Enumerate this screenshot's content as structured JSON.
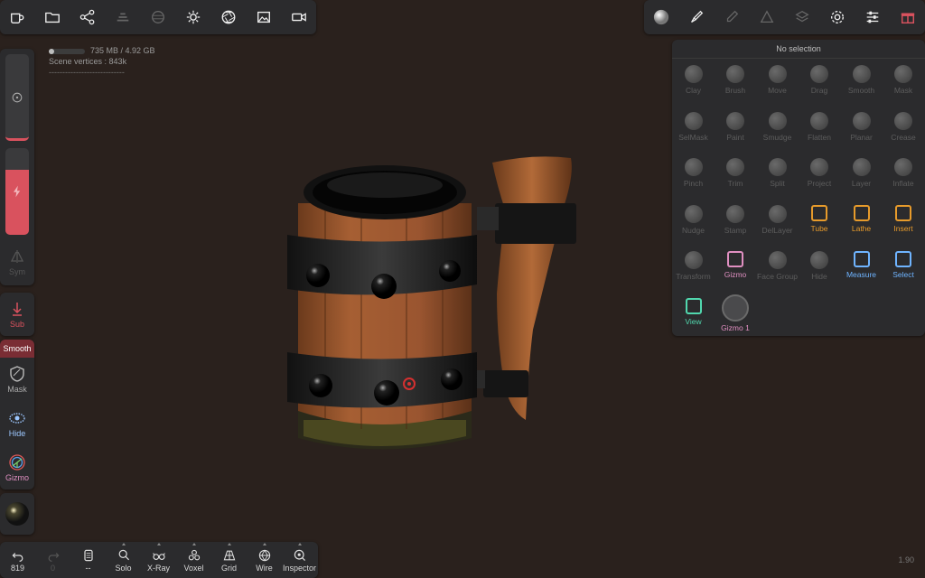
{
  "top_left_toolbar": [
    {
      "icon": "mug-icon"
    },
    {
      "icon": "folder-icon"
    },
    {
      "icon": "scene-graph-icon"
    },
    {
      "icon": "layers-stack-icon"
    },
    {
      "icon": "texture-icon"
    },
    {
      "icon": "sun-icon"
    },
    {
      "icon": "aperture-icon"
    },
    {
      "icon": "image-icon"
    },
    {
      "icon": "video-camera-icon"
    }
  ],
  "top_right_toolbar": [
    {
      "icon": "material-sphere-icon"
    },
    {
      "icon": "paint-brush-icon"
    },
    {
      "icon": "pen-icon"
    },
    {
      "icon": "triangle-icon"
    },
    {
      "icon": "layers-icon"
    },
    {
      "icon": "settings-gear-icon"
    },
    {
      "icon": "sliders-icon"
    },
    {
      "icon": "gift-icon"
    }
  ],
  "scene_info": {
    "memory": "735 MB / 4.92 GB",
    "memory_fraction": 0.15,
    "vertices_label": "Scene vertices :",
    "vertices_value": "843k",
    "dashes": "----------------------------"
  },
  "left_sidebar": {
    "radius_icon": "radius-slider-icon",
    "intensity_icon": "intensity-slider-icon",
    "sym_label": "Sym",
    "sub_label": "Sub",
    "smooth_label": "Smooth",
    "mask_label": "Mask",
    "hide_label": "Hide",
    "gizmo_label": "Gizmo"
  },
  "tools_panel": {
    "header": "No selection",
    "tools": [
      {
        "label": "Clay",
        "state": "disabled"
      },
      {
        "label": "Brush",
        "state": "disabled"
      },
      {
        "label": "Move",
        "state": "disabled"
      },
      {
        "label": "Drag",
        "state": "disabled"
      },
      {
        "label": "Smooth",
        "state": "disabled"
      },
      {
        "label": "Mask",
        "state": "disabled"
      },
      {
        "label": "SelMask",
        "state": "disabled"
      },
      {
        "label": "Paint",
        "state": "disabled"
      },
      {
        "label": "Smudge",
        "state": "disabled"
      },
      {
        "label": "Flatten",
        "state": "disabled"
      },
      {
        "label": "Planar",
        "state": "disabled"
      },
      {
        "label": "Crease",
        "state": "disabled"
      },
      {
        "label": "Pinch",
        "state": "disabled"
      },
      {
        "label": "Trim",
        "state": "disabled"
      },
      {
        "label": "Split",
        "state": "disabled"
      },
      {
        "label": "Project",
        "state": "disabled"
      },
      {
        "label": "Layer",
        "state": "disabled"
      },
      {
        "label": "Inflate",
        "state": "disabled"
      },
      {
        "label": "Nudge",
        "state": "disabled"
      },
      {
        "label": "Stamp",
        "state": "disabled"
      },
      {
        "label": "DelLayer",
        "state": "disabled"
      },
      {
        "label": "Tube",
        "state": "orange"
      },
      {
        "label": "Lathe",
        "state": "orange"
      },
      {
        "label": "Insert",
        "state": "orange"
      },
      {
        "label": "Transform",
        "state": "disabled"
      },
      {
        "label": "Gizmo",
        "state": "pink"
      },
      {
        "label": "Face Group",
        "state": "disabled"
      },
      {
        "label": "Hide",
        "state": "disabled"
      },
      {
        "label": "Measure",
        "state": "blue"
      },
      {
        "label": "Select",
        "state": "blue"
      },
      {
        "label": "View",
        "state": "green"
      },
      {
        "label": "Gizmo 1",
        "state": "selected"
      }
    ]
  },
  "bottom_toolbar": [
    {
      "label": "819",
      "icon": "undo-icon"
    },
    {
      "label": "0",
      "icon": "redo-icon"
    },
    {
      "label": "--",
      "icon": "mesh-icon"
    },
    {
      "label": "Solo",
      "icon": "search-icon"
    },
    {
      "label": "X-Ray",
      "icon": "glasses-icon"
    },
    {
      "label": "Voxel",
      "icon": "voxel-icon"
    },
    {
      "label": "Grid",
      "icon": "grid-icon"
    },
    {
      "label": "Wire",
      "icon": "wireframe-icon"
    },
    {
      "label": "Inspector",
      "icon": "inspector-icon"
    }
  ],
  "version": "1.90",
  "colors": {
    "background": "#2a211d",
    "panel": "#2b2b2d",
    "accent_orange": "#e79b2b",
    "accent_blue": "#6fb4ff",
    "accent_green": "#51d7ae",
    "accent_red": "#d9525e",
    "accent_pink": "#e08fc1"
  }
}
